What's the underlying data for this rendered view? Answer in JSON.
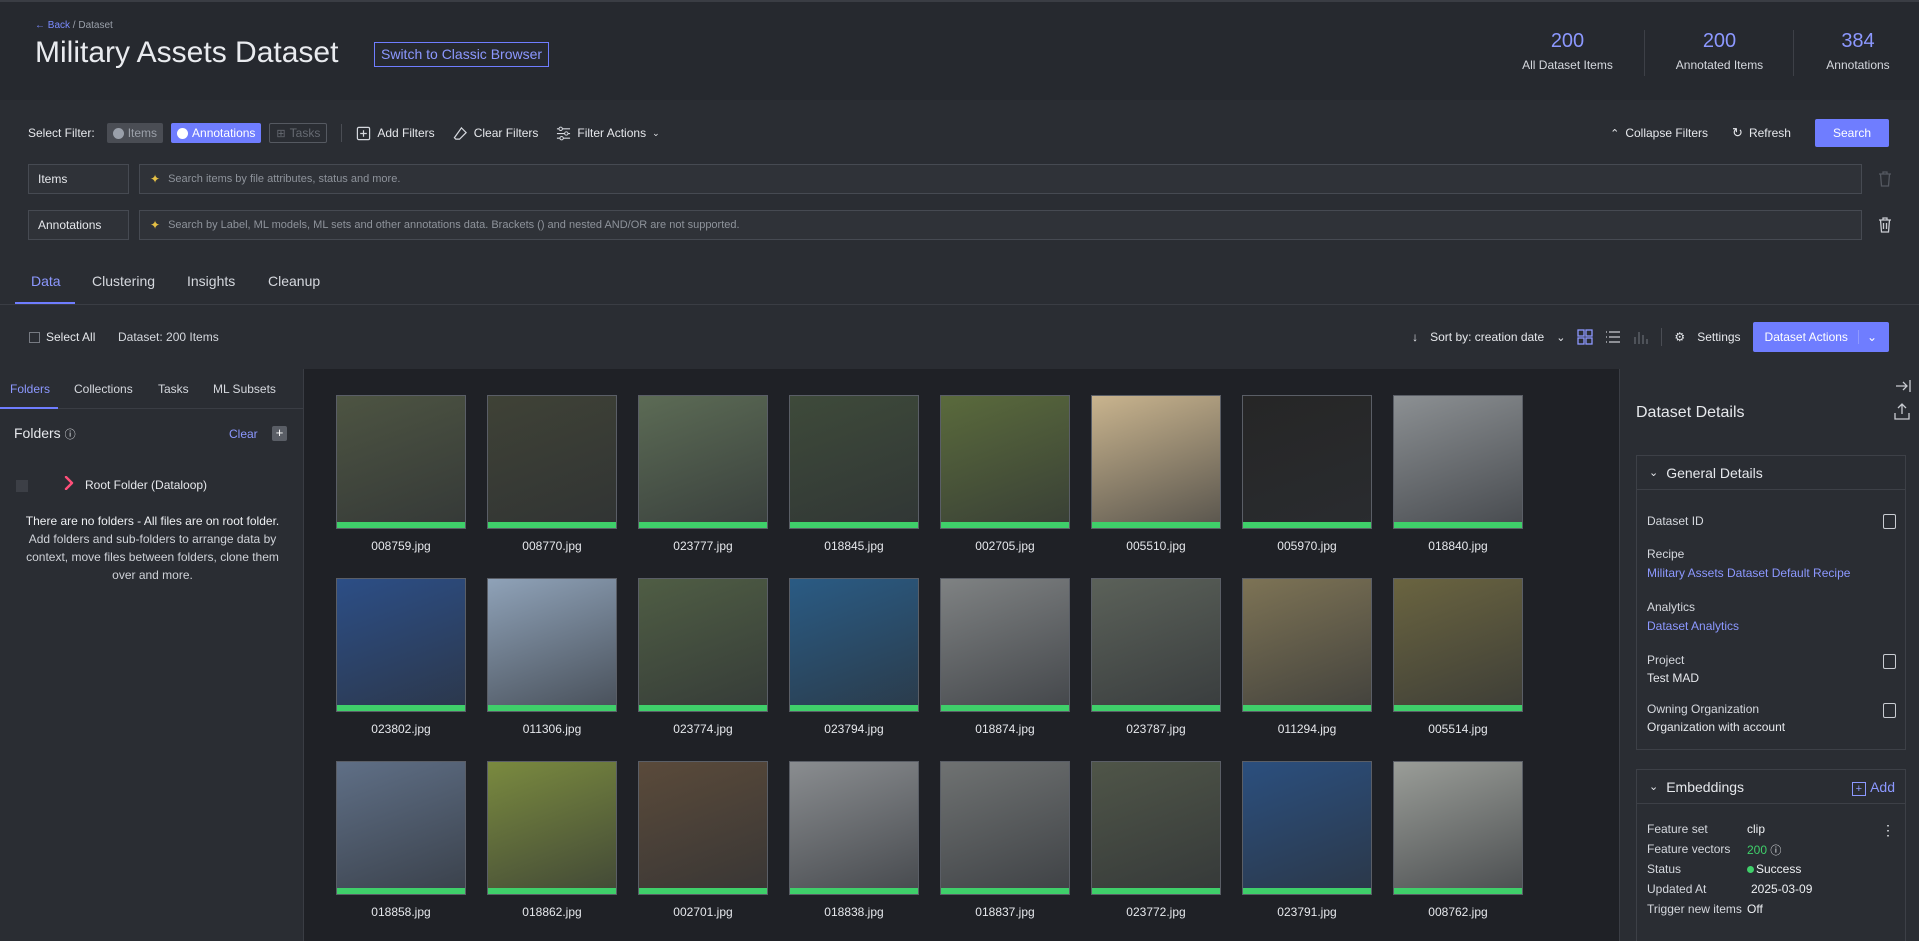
{
  "header": {
    "back_label": "← Back",
    "crumb_sep": "/",
    "crumb": "Dataset",
    "title": "Military Assets Dataset",
    "classic_button": "Switch to Classic Browser",
    "stats": [
      {
        "value": "200",
        "label": "All Dataset Items"
      },
      {
        "value": "200",
        "label": "Annotated Items"
      },
      {
        "value": "384",
        "label": "Annotations"
      }
    ]
  },
  "filters": {
    "select_label": "Select Filter:",
    "chip_items": "Items",
    "chip_annotations": "Annotations",
    "chip_tasks": "Tasks",
    "add_filters": "Add Filters",
    "clear_filters": "Clear Filters",
    "filter_actions": "Filter Actions",
    "collapse_filters": "Collapse Filters",
    "refresh": "Refresh",
    "search": "Search",
    "rows": [
      {
        "label": "Items",
        "placeholder": "Search items by file attributes, status and more."
      },
      {
        "label": "Annotations",
        "placeholder": "Search by Label, ML models, ML sets and other annotations data. Brackets () and nested AND/OR are not supported."
      }
    ]
  },
  "tabs": [
    "Data",
    "Clustering",
    "Insights",
    "Cleanup"
  ],
  "toolbar": {
    "select_all": "Select All",
    "dataset_count": "Dataset: 200 Items",
    "sort_label": "Sort by: creation date",
    "settings": "Settings",
    "dataset_actions": "Dataset Actions"
  },
  "sidebar": {
    "tabs": [
      "Folders",
      "Collections",
      "Tasks",
      "ML Subsets"
    ],
    "heading": "Folders",
    "clear": "Clear",
    "root_folder": "Root Folder (Dataloop)",
    "empty_title": "There are no folders - All files are on root folder.",
    "empty_body": "Add folders and sub-folders to arrange data by context, move files between folders, clone them over and more."
  },
  "grid": {
    "items": [
      {
        "name": "008759.jpg",
        "bg": "#4d5442"
      },
      {
        "name": "008770.jpg",
        "bg": "#3f4236"
      },
      {
        "name": "023777.jpg",
        "bg": "#5c6b55"
      },
      {
        "name": "018845.jpg",
        "bg": "#3e4a3a"
      },
      {
        "name": "002705.jpg",
        "bg": "#5a6a3c"
      },
      {
        "name": "005510.jpg",
        "bg": "#c9b48e"
      },
      {
        "name": "005970.jpg",
        "bg": "#262626"
      },
      {
        "name": "018840.jpg",
        "bg": "#8c9093"
      },
      {
        "name": "023802.jpg",
        "bg": "#2c4e86"
      },
      {
        "name": "011306.jpg",
        "bg": "#8fa2b8"
      },
      {
        "name": "023774.jpg",
        "bg": "#4f5d44"
      },
      {
        "name": "023794.jpg",
        "bg": "#2a5b84"
      },
      {
        "name": "018874.jpg",
        "bg": "#7f8283"
      },
      {
        "name": "023787.jpg",
        "bg": "#5b6159"
      },
      {
        "name": "011294.jpg",
        "bg": "#7d7355"
      },
      {
        "name": "005514.jpg",
        "bg": "#6a6440"
      },
      {
        "name": "018858.jpg",
        "bg": "#5f6f86"
      },
      {
        "name": "018862.jpg",
        "bg": "#7a8a3f"
      },
      {
        "name": "002701.jpg",
        "bg": "#5a4a3a"
      },
      {
        "name": "018838.jpg",
        "bg": "#8a8d90"
      },
      {
        "name": "018837.jpg",
        "bg": "#6f7272"
      },
      {
        "name": "023772.jpg",
        "bg": "#4f5548"
      },
      {
        "name": "023791.jpg",
        "bg": "#2b4f7e"
      },
      {
        "name": "008762.jpg",
        "bg": "#9a9d98"
      }
    ]
  },
  "details": {
    "title": "Dataset Details",
    "general_title": "General Details",
    "dataset_id_label": "Dataset ID",
    "recipe_label": "Recipe",
    "recipe_value": "Military Assets Dataset Default Recipe",
    "analytics_label": "Analytics",
    "analytics_value": "Dataset Analytics",
    "project_label": "Project",
    "project_value": "Test MAD",
    "org_label": "Owning Organization",
    "org_value": "Organization with account",
    "embeddings_title": "Embeddings",
    "add_label": "Add",
    "feature_set_label": "Feature set",
    "feature_set_value": "clip",
    "feature_vectors_label": "Feature vectors",
    "feature_vectors_value": "200",
    "status_label": "Status",
    "status_value": "Success",
    "updated_label": "Updated At",
    "updated_value": "2025-03-09",
    "trigger_label": "Trigger new items",
    "trigger_value": "Off"
  },
  "colors": {
    "accent": "#6f7dff",
    "success": "#3fcf6a",
    "background": "#1f2126",
    "panel": "#2a2d33"
  }
}
